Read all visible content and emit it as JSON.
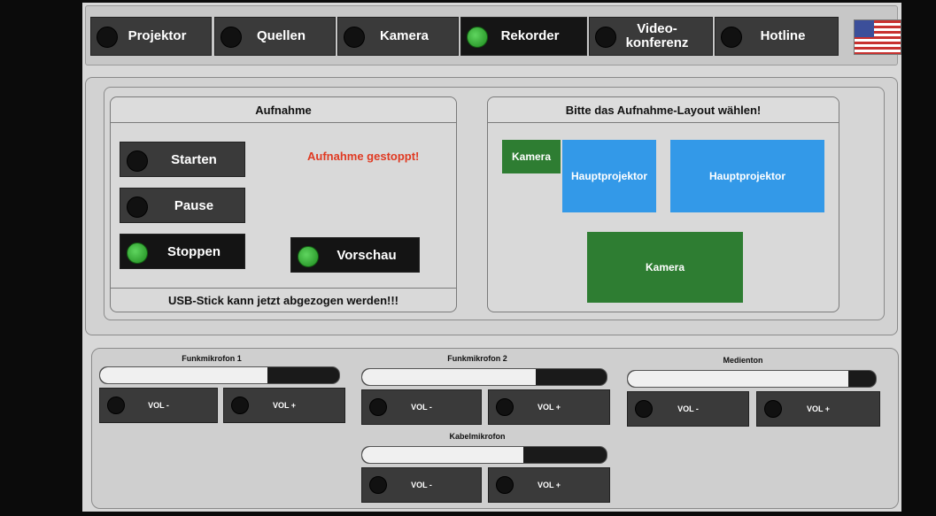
{
  "nav": {
    "items": [
      {
        "label": "Projektor",
        "active": false
      },
      {
        "label": "Quellen",
        "active": false
      },
      {
        "label": "Kamera",
        "active": false
      },
      {
        "label": "Rekorder",
        "active": true
      },
      {
        "label": "Video-\nkonferenz",
        "active": false
      },
      {
        "label": "Hotline",
        "active": false
      }
    ],
    "language_icon": "us-flag-icon"
  },
  "recording": {
    "title": "Aufnahme",
    "start_label": "Starten",
    "pause_label": "Pause",
    "stop_label": "Stoppen",
    "preview_label": "Vorschau",
    "status": "Aufnahme gestoppt!",
    "message": "USB-Stick kann jetzt abgezogen werden!!!"
  },
  "layout": {
    "title": "Bitte das Aufnahme-Layout wählen!",
    "option1_camera": "Kamera",
    "option1_projector": "Hauptprojektor",
    "option2_projector": "Hauptprojektor",
    "option3_camera": "Kamera"
  },
  "audio": {
    "channels": [
      {
        "label": "Funkmikrofon 1",
        "level": 0.7,
        "vol_down": "VOL -",
        "vol_up": "VOL +"
      },
      {
        "label": "Funkmikrofon 2",
        "level": 0.71,
        "vol_down": "VOL -",
        "vol_up": "VOL +"
      },
      {
        "label": "Medienton",
        "level": 0.89,
        "vol_down": "VOL -",
        "vol_up": "VOL +"
      },
      {
        "label": "Kabelmikrofon",
        "level": 0.66,
        "vol_down": "VOL -",
        "vol_up": "VOL +"
      }
    ]
  },
  "colors": {
    "status_red": "#e03a22",
    "tile_green": "#2e7d32",
    "tile_blue": "#3399e8",
    "led_green": "#3cb83c"
  }
}
